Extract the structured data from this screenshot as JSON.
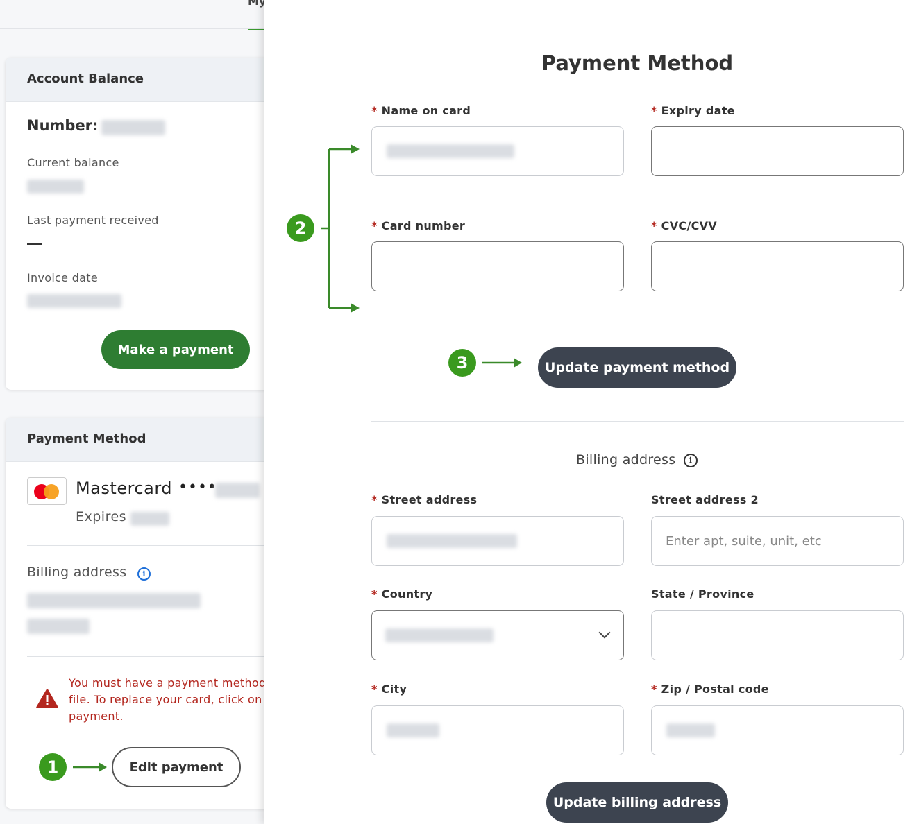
{
  "top_tab": {
    "label": "My"
  },
  "account_balance": {
    "title": "Account Balance",
    "number_label": "Number:",
    "current_balance_label": "Current balance",
    "last_payment_label": "Last payment received",
    "last_payment_value": "—",
    "invoice_date_label": "Invoice date",
    "make_payment_button": "Make a payment"
  },
  "payment_method_card": {
    "title": "Payment Method",
    "card_brand": "Mastercard",
    "masked_dots": "••••",
    "expires_label": "Expires",
    "billing_address_label": "Billing address",
    "warning_text": "You must have a payment method on file. To replace your card, click on edit payment.",
    "edit_payment_button": "Edit payment"
  },
  "modal": {
    "title": "Payment Method",
    "fields": {
      "name_on_card": "Name on card",
      "expiry_date": "Expiry date",
      "card_number": "Card number",
      "cvc": "CVC/CVV"
    },
    "update_payment_button": "Update payment method",
    "billing_section_title": "Billing address",
    "billing_fields": {
      "street_address": "Street address",
      "street_address_2": "Street address 2",
      "street_address_2_placeholder": "Enter apt, suite, unit, etc",
      "country": "Country",
      "state": "State / Province",
      "city": "City",
      "zip": "Zip / Postal code"
    },
    "update_billing_button": "Update billing address"
  },
  "annotations": {
    "step1": "1",
    "step2": "2",
    "step3": "3"
  },
  "colors": {
    "accent_green": "#2e7d32",
    "annotation_green": "#3a9a1e",
    "dark_button": "#3d4450",
    "required_red": "#b3261e",
    "info_blue": "#1e6fd9"
  }
}
